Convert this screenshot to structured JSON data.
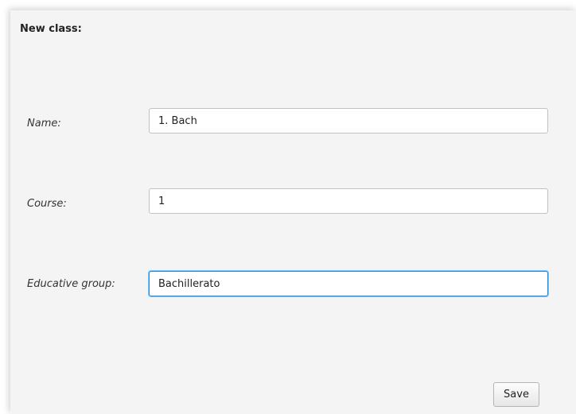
{
  "form": {
    "title": "New class:",
    "fields": [
      {
        "label": "Name:",
        "value": "1. Bach"
      },
      {
        "label": "Course:",
        "value": "1"
      },
      {
        "label": "Educative group:",
        "value": "Bachillerato"
      }
    ],
    "focused_field": "Educative group:",
    "save_label": "Save"
  },
  "colors": {
    "panel_background": "#f4f4f4",
    "focus_border": "#1a8fe3"
  }
}
